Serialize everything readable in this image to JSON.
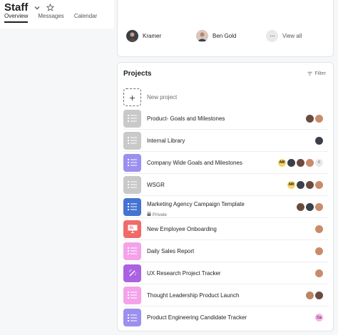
{
  "header": {
    "title": "Staff",
    "tabs": [
      {
        "label": "Overview",
        "active": true
      },
      {
        "label": "Messages",
        "active": false
      },
      {
        "label": "Calendar",
        "active": false
      }
    ]
  },
  "members": {
    "items": [
      {
        "name": "Kramer"
      },
      {
        "name": "Ben Gold"
      }
    ],
    "view_all_label": "View all"
  },
  "projects": {
    "title": "Projects",
    "filter_label": "Filter",
    "new_project_label": "New project",
    "items": [
      {
        "name": "Product- Goals and Milestones",
        "icon": "list-icon",
        "color": "#c9c9c9"
      },
      {
        "name": "Internal Library",
        "icon": "list-icon",
        "color": "#c9c9c9"
      },
      {
        "name": "Company Wide Goals and Milestones",
        "icon": "list-icon",
        "color": "#9b8ff0"
      },
      {
        "name": "WSGR",
        "icon": "list-icon",
        "color": "#c9c9c9"
      },
      {
        "name": "Marketing Agency Campaign Template",
        "subtitle": "Private",
        "icon": "list-icon",
        "color": "#4573d2"
      },
      {
        "name": "New Employee Onboarding",
        "icon": "presentation-icon",
        "color": "#f06a6a"
      },
      {
        "name": "Daily Sales Report",
        "icon": "list-icon",
        "color": "#f4a3ea"
      },
      {
        "name": "UX Research Project Tracker",
        "icon": "magic-wand-icon",
        "color": "#aa62e3"
      },
      {
        "name": "Thought Leadership Product Launch",
        "icon": "list-icon",
        "color": "#f4a3ea"
      },
      {
        "name": "Product Engineering Candidate Tracker",
        "icon": "list-icon",
        "color": "#9b8ff0"
      }
    ],
    "avatar_texts": {
      "aw": "AW",
      "ca": "Ca",
      "more_count": "6"
    }
  }
}
